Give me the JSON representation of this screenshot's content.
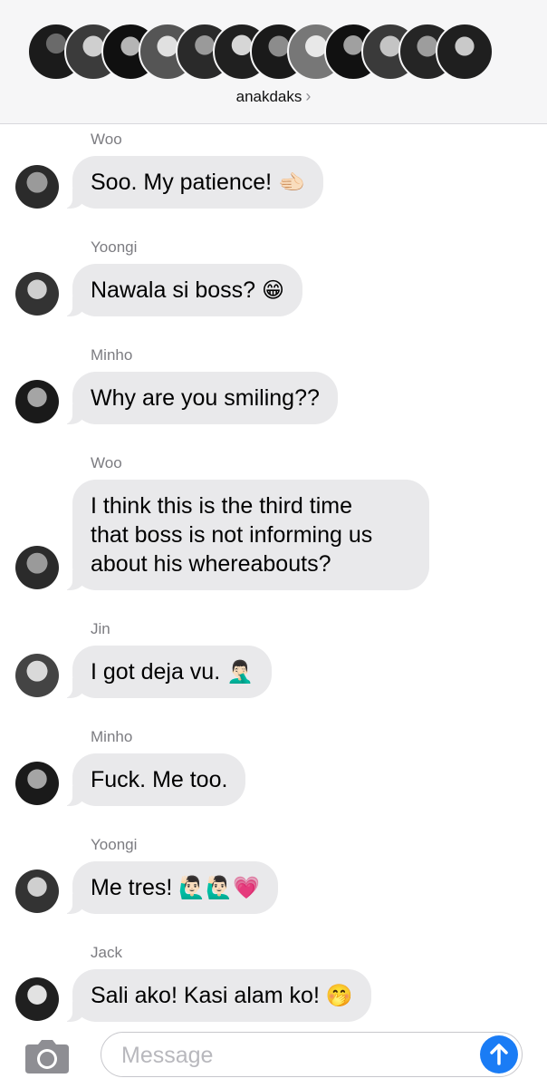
{
  "header": {
    "group_name": "anakdaks",
    "chevron": "›",
    "member_avatars": [
      "avatar-1",
      "avatar-2",
      "avatar-3",
      "avatar-4",
      "avatar-5",
      "avatar-6",
      "avatar-7",
      "avatar-8",
      "avatar-9",
      "avatar-10",
      "avatar-11",
      "avatar-12"
    ]
  },
  "messages": [
    {
      "sender": "Woo",
      "text": "Soo. My patience!",
      "emoji": "🫲🏻"
    },
    {
      "sender": "Yoongi",
      "text": "Nawala si boss?",
      "emoji": "😁"
    },
    {
      "sender": "Minho",
      "text": "Why are you smiling??",
      "emoji": ""
    },
    {
      "sender": "Woo",
      "text_lines": [
        "I think this is the third time",
        "that boss is not informing us",
        "about his whereabouts?"
      ]
    },
    {
      "sender": "Jin",
      "text": "I got deja vu.",
      "emoji": "🤦🏻‍♂️"
    },
    {
      "sender": "Minho",
      "text": "Fuck. Me too.",
      "emoji": ""
    },
    {
      "sender": "Yoongi",
      "text": "Me tres!",
      "emoji": "🙋🏻‍♂️🙋🏻‍♂️💗"
    },
    {
      "sender": "Jack",
      "text": "Sali ako! Kasi alam ko!",
      "emoji": "🤭"
    }
  ],
  "composer": {
    "placeholder": "Message",
    "camera_icon": "camera-icon",
    "send_icon": "arrow-up-icon",
    "accent": "#1a7cf5"
  }
}
